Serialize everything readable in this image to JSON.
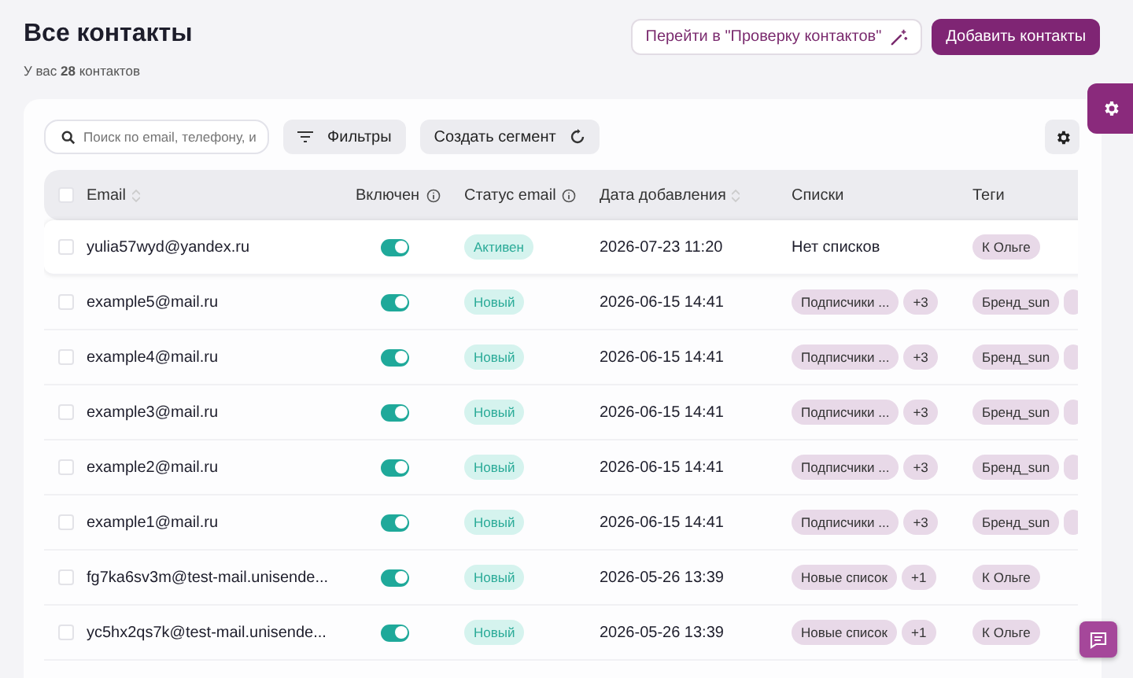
{
  "header": {
    "title": "Все контакты",
    "subtitle": "У вас **28** контактов",
    "check_button": "Перейти в \"Проверку контактов\"",
    "add_button": "Добавить контакты"
  },
  "toolbar": {
    "search_placeholder": "Поиск по email, телефону, и",
    "filters": "Фильтры",
    "segment": "Создать сегмент"
  },
  "table": {
    "columns": [
      {
        "label": "Email",
        "sortable": true,
        "info": false
      },
      {
        "label": "Включен",
        "sortable": false,
        "info": true
      },
      {
        "label": "Статус email",
        "sortable": false,
        "info": true
      },
      {
        "label": "Дата добавления",
        "sortable": true,
        "info": false
      },
      {
        "label": "Списки",
        "sortable": false,
        "info": false
      },
      {
        "label": "Теги",
        "sortable": false,
        "info": false
      }
    ],
    "rows": [
      {
        "checked": false,
        "email": "yulia57wyd@yandex.ru",
        "enabled": true,
        "status": "Активен",
        "date": "2026-07-23 11:20",
        "lists_text": "Нет списков",
        "lists": [],
        "tags": [
          "К Ольге"
        ],
        "tags_overflow": false,
        "hovered": true
      },
      {
        "checked": false,
        "email": "example5@mail.ru",
        "enabled": true,
        "status": "Новый",
        "date": "2026-06-15 14:41",
        "lists": [
          "Подписчики ...",
          "+3"
        ],
        "tags": [
          "Бренд_sun"
        ],
        "tags_overflow": true,
        "hovered": false
      },
      {
        "checked": false,
        "email": "example4@mail.ru",
        "enabled": true,
        "status": "Новый",
        "date": "2026-06-15 14:41",
        "lists": [
          "Подписчики ...",
          "+3"
        ],
        "tags": [
          "Бренд_sun"
        ],
        "tags_overflow": true,
        "hovered": false
      },
      {
        "checked": false,
        "email": "example3@mail.ru",
        "enabled": true,
        "status": "Новый",
        "date": "2026-06-15 14:41",
        "lists": [
          "Подписчики ...",
          "+3"
        ],
        "tags": [
          "Бренд_sun"
        ],
        "tags_overflow": true,
        "hovered": false
      },
      {
        "checked": false,
        "email": "example2@mail.ru",
        "enabled": true,
        "status": "Новый",
        "date": "2026-06-15 14:41",
        "lists": [
          "Подписчики ...",
          "+3"
        ],
        "tags": [
          "Бренд_sun"
        ],
        "tags_overflow": true,
        "hovered": false
      },
      {
        "checked": false,
        "email": "example1@mail.ru",
        "enabled": true,
        "status": "Новый",
        "date": "2026-06-15 14:41",
        "lists": [
          "Подписчики ...",
          "+3"
        ],
        "tags": [
          "Бренд_sun"
        ],
        "tags_overflow": true,
        "hovered": false
      },
      {
        "checked": false,
        "email": "fg7ka6sv3m@test-mail.unisende...",
        "enabled": true,
        "status": "Новый",
        "date": "2026-05-26 13:39",
        "lists": [
          "Новые список",
          "+1"
        ],
        "tags": [
          "К Ольге"
        ],
        "tags_overflow": false,
        "hovered": false
      },
      {
        "checked": false,
        "email": "yc5hx2qs7k@test-mail.unisende...",
        "enabled": true,
        "status": "Новый",
        "date": "2026-05-26 13:39",
        "lists": [
          "Новые список",
          "+1"
        ],
        "tags": [
          "К Ольге"
        ],
        "tags_overflow": false,
        "hovered": false
      }
    ]
  },
  "select_all": {
    "checked": false
  }
}
